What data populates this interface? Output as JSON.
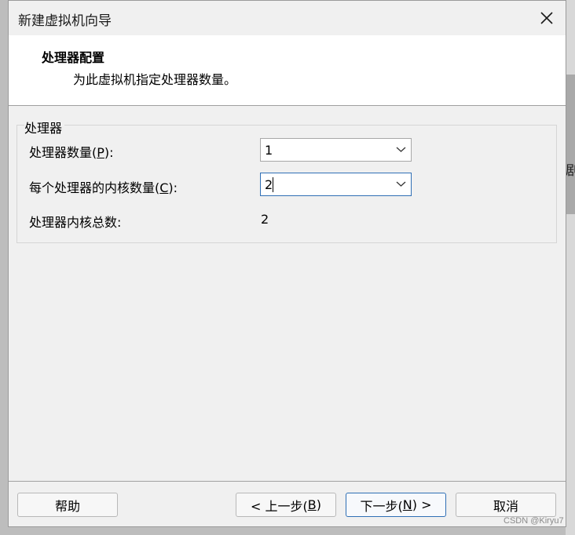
{
  "window": {
    "title": "新建虚拟机向导"
  },
  "header": {
    "title": "处理器配置",
    "subtitle": "为此虚拟机指定处理器数量。"
  },
  "group": {
    "legend": "处理器"
  },
  "rows": {
    "processors": {
      "label_pre": "处理器数量(",
      "label_key": "P",
      "label_post": "):",
      "value": "1"
    },
    "cores": {
      "label_pre": "每个处理器的内核数量(",
      "label_key": "C",
      "label_post": "):",
      "value": "2"
    },
    "total": {
      "label": "处理器内核总数:",
      "value": "2"
    }
  },
  "buttons": {
    "help": "帮助",
    "back_pre": "< 上一步(",
    "back_key": "B",
    "back_post": ")",
    "next_pre": "下一步(",
    "next_key": "N",
    "next_post": ") >",
    "cancel": "取消"
  },
  "watermark": "CSDN @Kiryu7",
  "icons": {
    "close": "close-icon",
    "dropdown": "chevron-down-icon"
  },
  "colors": {
    "focus_border": "#2f6fb5",
    "dialog_bg": "#f0f0f0",
    "header_bg": "#ffffff"
  }
}
